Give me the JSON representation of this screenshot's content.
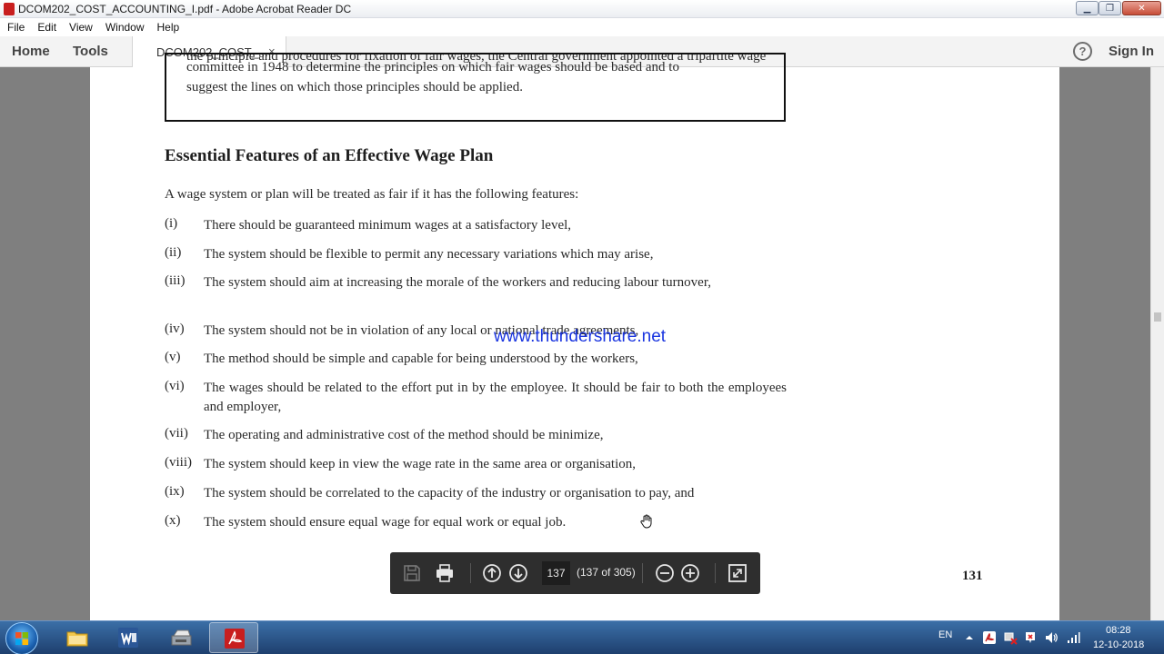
{
  "window": {
    "title": "DCOM202_COST_ACCOUNTING_I.pdf - Adobe Acrobat Reader DC"
  },
  "menu": [
    "File",
    "Edit",
    "View",
    "Window",
    "Help"
  ],
  "tabs": {
    "home": "Home",
    "tools": "Tools",
    "doc": "DCOM202_COST_...",
    "close": "×",
    "signin": "Sign In",
    "help": "?"
  },
  "document": {
    "box_cut_line": "the principle and procedures for fixation of fair wages, the Central government appointed a tripartite wage",
    "box_lines": [
      "committee in 1948 to determine the principles on which fair wages should be based and to",
      "suggest the lines on which those principles should be applied."
    ],
    "heading": "Essential Features of an Effective Wage Plan",
    "intro": "A wage system or plan will be treated as fair if it has the following features:",
    "items": [
      {
        "num": "(i)",
        "text": "There should be guaranteed minimum wages at a satisfactory level,"
      },
      {
        "num": "(ii)",
        "text": "The system should be flexible to permit any necessary variations which may arise,"
      },
      {
        "num": "(iii)",
        "text": "The system should aim at increasing the morale of the workers and reducing labour turnover,"
      },
      {
        "num": "(iv)",
        "text": "The system should not be in violation of any local or national trade agreements,"
      },
      {
        "num": "(v)",
        "text": "The method should be simple and capable for being understood by the workers,"
      },
      {
        "num": "(vi)",
        "text": "The wages should be related to the effort put in by the employee. It should be fair to both the employees and employer,"
      },
      {
        "num": "(vii)",
        "text": "The operating and administrative cost of the method should be minimize,"
      },
      {
        "num": "(viii)",
        "text": "The system should keep in view the wage rate in the same area or organisation,"
      },
      {
        "num": "(ix)",
        "text": "The system should be correlated to the capacity of the industry or organisation to pay, and"
      },
      {
        "num": "(x)",
        "text": "The system should ensure equal wage for equal work or equal job."
      }
    ],
    "watermark": "www.thundershare.net",
    "page_number": "131"
  },
  "page_toolbar": {
    "current_page": "137",
    "page_count": "(137 of 305)"
  },
  "taskbar": {
    "lang": "EN",
    "time": "08:28",
    "date": "12-10-2018"
  },
  "colors": {
    "watermark": "#1a35e0",
    "acrobat_red": "#c81e1e",
    "toolbar_bg": "#2e2e2e"
  },
  "icons": [
    "save-icon",
    "print-icon",
    "previous-page-icon",
    "next-page-icon",
    "zoom-out-icon",
    "zoom-in-icon",
    "fit-page-icon",
    "help-icon",
    "hand-cursor-icon"
  ]
}
